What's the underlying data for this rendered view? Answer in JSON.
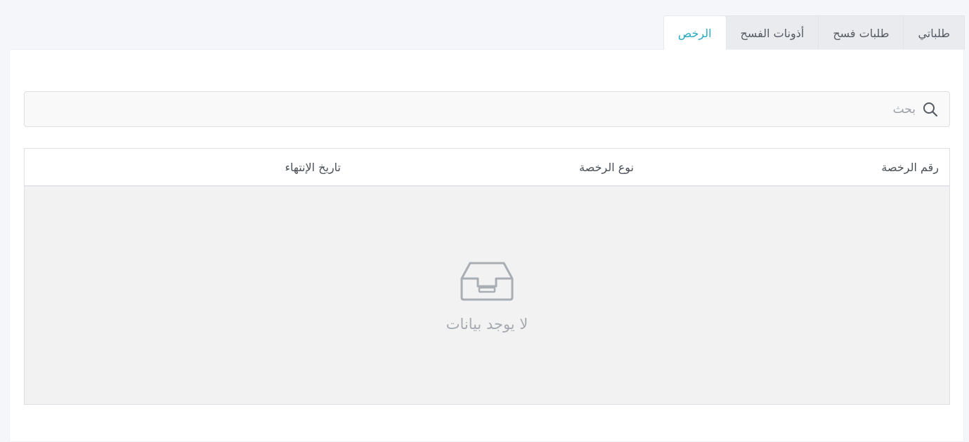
{
  "tabs": [
    {
      "label": "طلباتي",
      "active": false
    },
    {
      "label": "طلبات فسح",
      "active": false
    },
    {
      "label": "أذونات الفسح",
      "active": false
    },
    {
      "label": "الرخص",
      "active": true
    }
  ],
  "search": {
    "placeholder": "بحث",
    "value": "",
    "icon": "search-icon"
  },
  "table": {
    "columns": [
      "رقم الرخصة",
      "نوع الرخصة",
      "تاريخ الإنتهاء"
    ],
    "rows": [],
    "empty_text": "لا يوجد بيانات",
    "empty_icon": "inbox-icon"
  },
  "colors": {
    "accent": "#25a7c4",
    "background": "#f4f6fa",
    "empty_area": "#f2f2f2"
  }
}
